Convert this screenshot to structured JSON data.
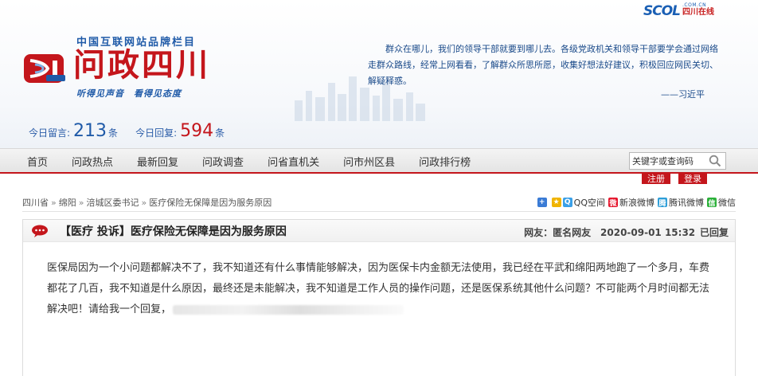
{
  "site_logo": {
    "main": "SCOL",
    "domain": ".COM.CN",
    "cn": "四川在线"
  },
  "brand": {
    "tagline": "中国互联网站品牌栏目",
    "title": "问政四川",
    "slogan": "听得见声音　看得见态度"
  },
  "quote": {
    "text": "群众在哪儿，我们的领导干部就要到哪儿去。各级党政机关和领导干部要学会通过网络走群众路线，经常上网看看，了解群众所思所愿，收集好想法好建议，积极回应网民关切、解疑释惑。",
    "author": "——习近平"
  },
  "counters": {
    "today_posts_label": "今日留言:",
    "today_posts": "213",
    "today_replies_label": "今日回复:",
    "today_replies": "594",
    "unit": "条"
  },
  "nav": {
    "items": [
      "首页",
      "问政热点",
      "最新回复",
      "问政调查",
      "问省直机关",
      "问市州区县",
      "问政排行榜"
    ],
    "search_placeholder": "关键字或查询码"
  },
  "auth": {
    "register": "注册",
    "login": "登录"
  },
  "breadcrumb": [
    "四川省",
    "绵阳",
    "涪城区委书记",
    "医疗保险无保障是因为服务原因"
  ],
  "share": [
    {
      "label": "",
      "icon": "plus-icon",
      "color": "#3a7bd5"
    },
    {
      "label": "",
      "icon": "qzone-star-icon",
      "color": "#f0b400"
    },
    {
      "label": "QQ空间",
      "icon": "qq-icon",
      "color": "#3aa0e8"
    },
    {
      "label": "新浪微博",
      "icon": "weibo-icon",
      "color": "#e6162d"
    },
    {
      "label": "腾讯微博",
      "icon": "tencent-weibo-icon",
      "color": "#2d9ed8"
    },
    {
      "label": "微信",
      "icon": "wechat-icon",
      "color": "#2cb13a"
    }
  ],
  "post": {
    "tag": "【医疗 投诉】",
    "title": "医疗保险无保障是因为服务原因",
    "author_label": "网友：",
    "author": "匿名网友",
    "datetime": "2020-09-01 15:32",
    "status": "已回复",
    "body": "医保局因为一个小问题都解决不了，我不知道还有什么事情能够解决，因为医保卡内金额无法使用，我已经在平武和绵阳两地跑了一个多月，车费都花了几百，我不知道是什么原因，最终还是未能解决，我不知道是工作人员的操作问题，还是医保系统其他什么问题？不可能两个月时间都无法解决吧！请给我一个回复，"
  },
  "colors": {
    "accent_red": "#c4161c",
    "brand_blue": "#1f5aa8"
  }
}
